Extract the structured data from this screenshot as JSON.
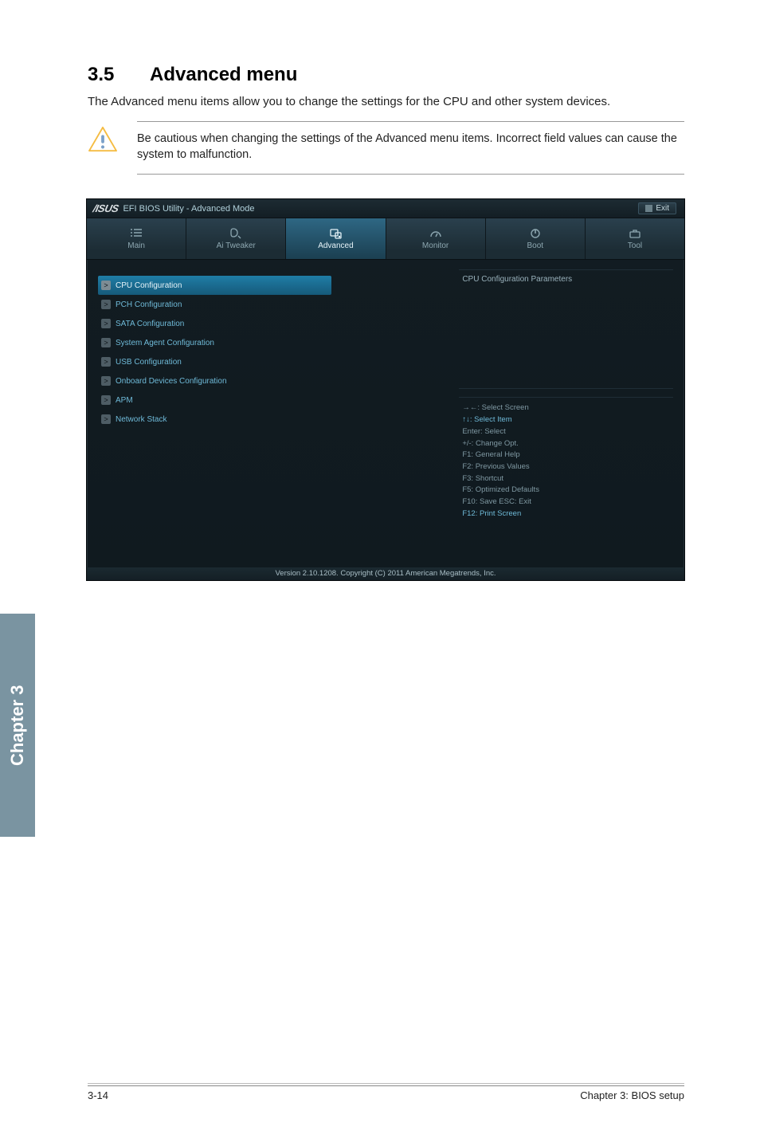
{
  "heading_number": "3.5",
  "heading_title": "Advanced menu",
  "intro": "The Advanced menu items allow you to change the settings for the CPU and other system devices.",
  "warning": "Be cautious when changing the settings of the Advanced menu items. Incorrect field values can cause the system to malfunction.",
  "bios": {
    "title": "EFI BIOS Utility - Advanced Mode",
    "exit_label": "Exit",
    "tabs": {
      "main": "Main",
      "ai_tweaker": "Ai  Tweaker",
      "advanced": "Advanced",
      "monitor": "Monitor",
      "boot": "Boot",
      "tool": "Tool"
    },
    "menu_items": [
      "CPU Configuration",
      "PCH Configuration",
      "SATA Configuration",
      "System Agent Configuration",
      "USB Configuration",
      "Onboard Devices Configuration",
      "APM",
      "Network Stack"
    ],
    "info_title": "CPU Configuration Parameters",
    "help": {
      "l1": "→←:  Select Screen",
      "l2": "↑↓:  Select Item",
      "l3": "Enter:  Select",
      "l4": "+/-:  Change Opt.",
      "l5": "F1:  General Help",
      "l6": "F2:  Previous Values",
      "l7": "F3:  Shortcut",
      "l8": "F5:  Optimized Defaults",
      "l9": "F10:  Save   ESC:  Exit",
      "l10": "F12: Print Screen"
    },
    "footer": "Version  2.10.1208.   Copyright  (C)  2011  American  Megatrends,  Inc."
  },
  "side_tab": "Chapter 3",
  "page_footer_left": "3-14",
  "page_footer_right": "Chapter 3: BIOS setup"
}
